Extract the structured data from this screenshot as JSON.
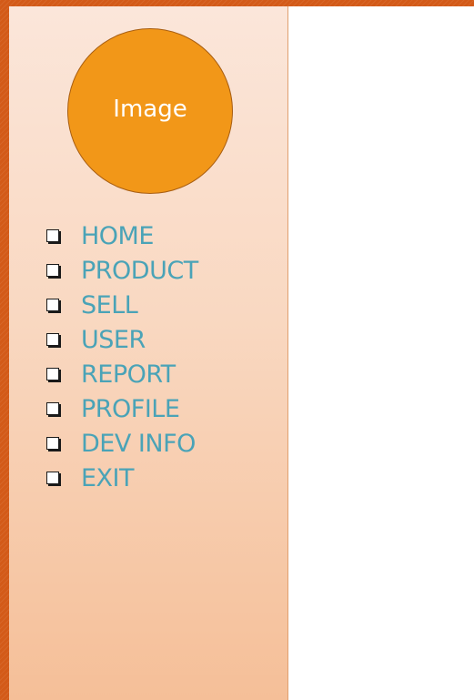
{
  "avatar": {
    "label": "Image",
    "fill": "#f29718"
  },
  "menu": {
    "label_color": "#4aa3b7",
    "items": [
      {
        "label": "HOME",
        "icon": "checkbox-icon"
      },
      {
        "label": "PRODUCT",
        "icon": "checkbox-icon"
      },
      {
        "label": "SELL",
        "icon": "checkbox-icon"
      },
      {
        "label": "USER",
        "icon": "checkbox-icon"
      },
      {
        "label": "REPORT",
        "icon": "checkbox-icon"
      },
      {
        "label": "PROFILE",
        "icon": "checkbox-icon"
      },
      {
        "label": "DEV INFO",
        "icon": "checkbox-icon"
      },
      {
        "label": "EXIT",
        "icon": "checkbox-icon"
      }
    ]
  },
  "theme": {
    "frame_color": "#d35a18",
    "sidebar_top": "#fbe6da",
    "sidebar_bottom": "#f5bf98"
  }
}
